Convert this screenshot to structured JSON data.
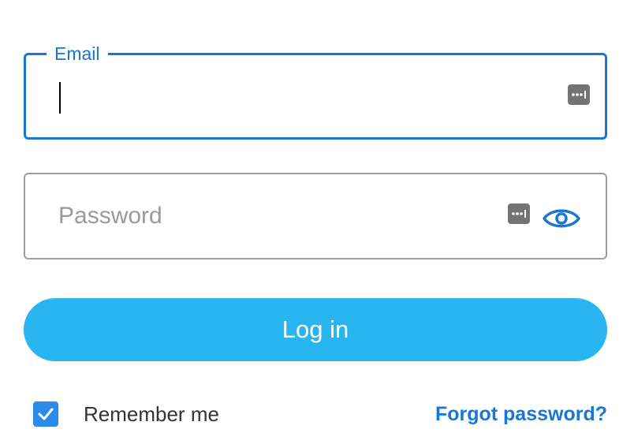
{
  "email": {
    "label": "Email",
    "value": "",
    "focused": true,
    "password_manager_icon": "password-manager-key-icon"
  },
  "password": {
    "placeholder": "Password",
    "value": "",
    "password_manager_icon": "password-manager-key-icon",
    "visibility_icon": "eye-icon"
  },
  "login_button": {
    "label": "Log in"
  },
  "remember_me": {
    "label": "Remember me",
    "checked": true,
    "icon": "checkmark-icon"
  },
  "forgot_password": {
    "label": "Forgot password?"
  },
  "colors": {
    "accent": "#1976d2",
    "button": "#29b6f0",
    "checkbox": "#2a8be8",
    "border": "#9e9e9e",
    "placeholder": "#9a9a9a"
  }
}
